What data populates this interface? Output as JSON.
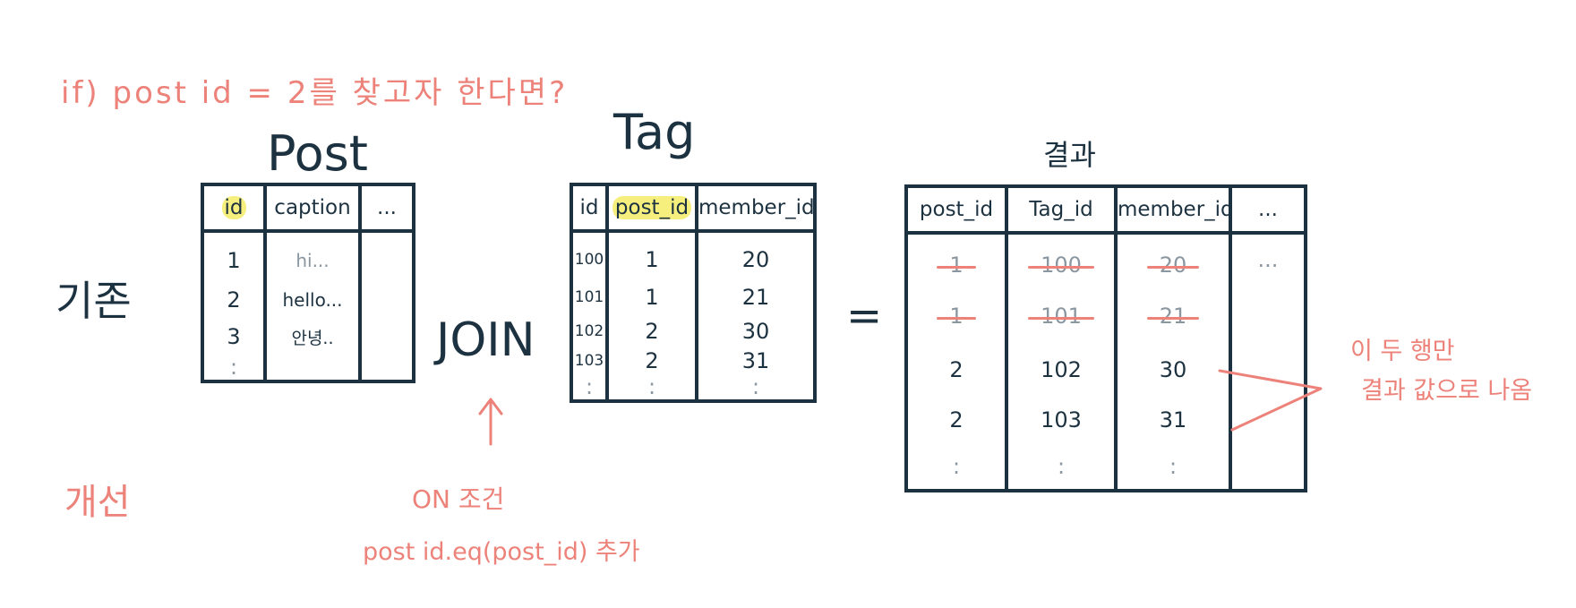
{
  "top_note": "if) post id = 2를 찾고자 한다면?",
  "labels": {
    "basic": "기존",
    "improved": "개선"
  },
  "post": {
    "title": "Post",
    "columns": [
      "id",
      "caption",
      "..."
    ],
    "rows": [
      [
        "1",
        "hi..."
      ],
      [
        "2",
        "hello..."
      ],
      [
        "3",
        "안녕.."
      ],
      [
        ":",
        ""
      ]
    ]
  },
  "join_label": "JOIN",
  "tag": {
    "title": "Tag",
    "columns": [
      "id",
      "post_id",
      "member_id"
    ],
    "rows": [
      [
        "100",
        "1",
        "20"
      ],
      [
        "101",
        "1",
        "21"
      ],
      [
        "102",
        "2",
        "30"
      ],
      [
        "103",
        "2",
        "31"
      ],
      [
        ":",
        ":",
        ":"
      ]
    ]
  },
  "equals": "=",
  "result": {
    "title": "결과",
    "columns": [
      "post_id",
      "Tag_id",
      "member_id",
      "..."
    ],
    "rows": [
      [
        "1",
        "100",
        "20"
      ],
      [
        "1",
        "101",
        "21"
      ],
      [
        "2",
        "102",
        "30"
      ],
      [
        "2",
        "103",
        "31"
      ],
      [
        ":",
        ":",
        ":"
      ]
    ],
    "extra_cell": "...",
    "struck_rows": [
      0,
      1
    ]
  },
  "annotation": {
    "line1": "이 두 행만",
    "line2": "결과 값으로 나옴"
  },
  "on_condition": {
    "line1": "ON 조건",
    "line2": "post id.eq(post_id) 추가"
  },
  "colors": {
    "ink": "#1d3240",
    "red": "#ec8279",
    "highlight": "#f6ef7e"
  }
}
